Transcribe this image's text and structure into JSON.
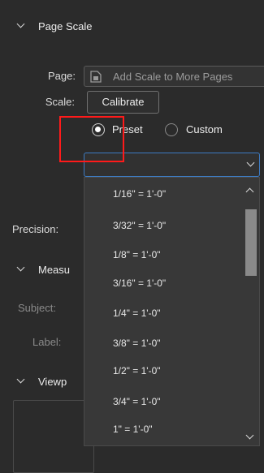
{
  "page_scale": {
    "title": "Page Scale",
    "page_label": "Page:",
    "page_value": "Add Scale to More Pages",
    "scale_label": "Scale:",
    "calibrate_label": "Calibrate",
    "preset_label": "Preset",
    "custom_label": "Custom",
    "preset_selected": true,
    "precision_label": "Precision:"
  },
  "measurement": {
    "title": "Measu",
    "subject_label": "Subject:",
    "label_label": "Label:"
  },
  "viewport": {
    "title": "Viewp"
  },
  "scale_dropdown": {
    "options": [
      "1/16\" = 1'-0\"",
      "3/32\" = 1'-0\"",
      "1/8\" = 1'-0\"",
      "3/16\" = 1'-0\"",
      "1/4\" = 1'-0\"",
      "3/8\" = 1'-0\"",
      "1/2\" = 1'-0\"",
      "3/4\" = 1'-0\"",
      "1\" = 1'-0\""
    ]
  },
  "colors": {
    "background": "#2b2b2b",
    "focus_border": "#3d7bc2",
    "highlight": "#ff1a1a"
  }
}
